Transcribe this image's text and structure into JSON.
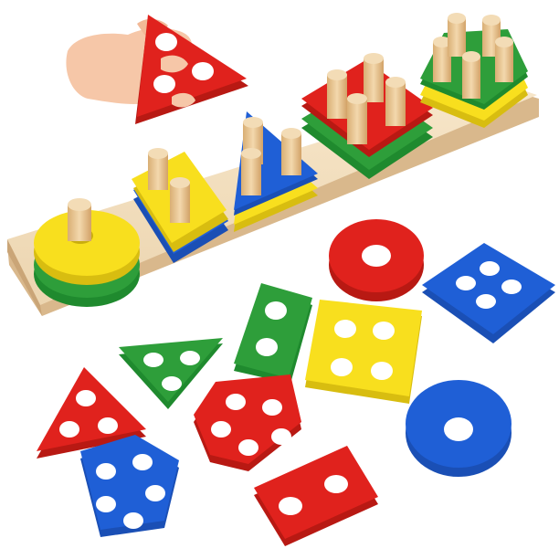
{
  "colors": {
    "red": "#e0221d",
    "yellow": "#f8df1e",
    "blue": "#1f5fd6",
    "green": "#2e9e3a",
    "wood": "#f1dcbc",
    "peg": "#e7c48f",
    "skin": "#f6c7a8"
  }
}
